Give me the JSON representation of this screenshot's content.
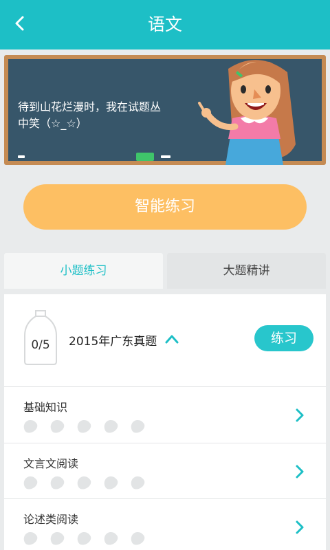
{
  "header": {
    "title": "语文"
  },
  "banner": {
    "text": "待到山花烂漫时，我在试题丛中笑（☆_☆）"
  },
  "smart_practice": {
    "label": "智能练习"
  },
  "tabs": [
    {
      "label": "小题练习",
      "active": true
    },
    {
      "label": "大题精讲",
      "active": false
    }
  ],
  "exam": {
    "progress": "0/5",
    "title": "2015年广东真题",
    "practice_label": "练习"
  },
  "categories": [
    {
      "label": "基础知识",
      "dots": 5
    },
    {
      "label": "文言文阅读",
      "dots": 5
    },
    {
      "label": "论述类阅读",
      "dots": 5
    }
  ],
  "colors": {
    "accent": "#1dbfc6",
    "button": "#fdbf63",
    "board": "#37566a"
  }
}
